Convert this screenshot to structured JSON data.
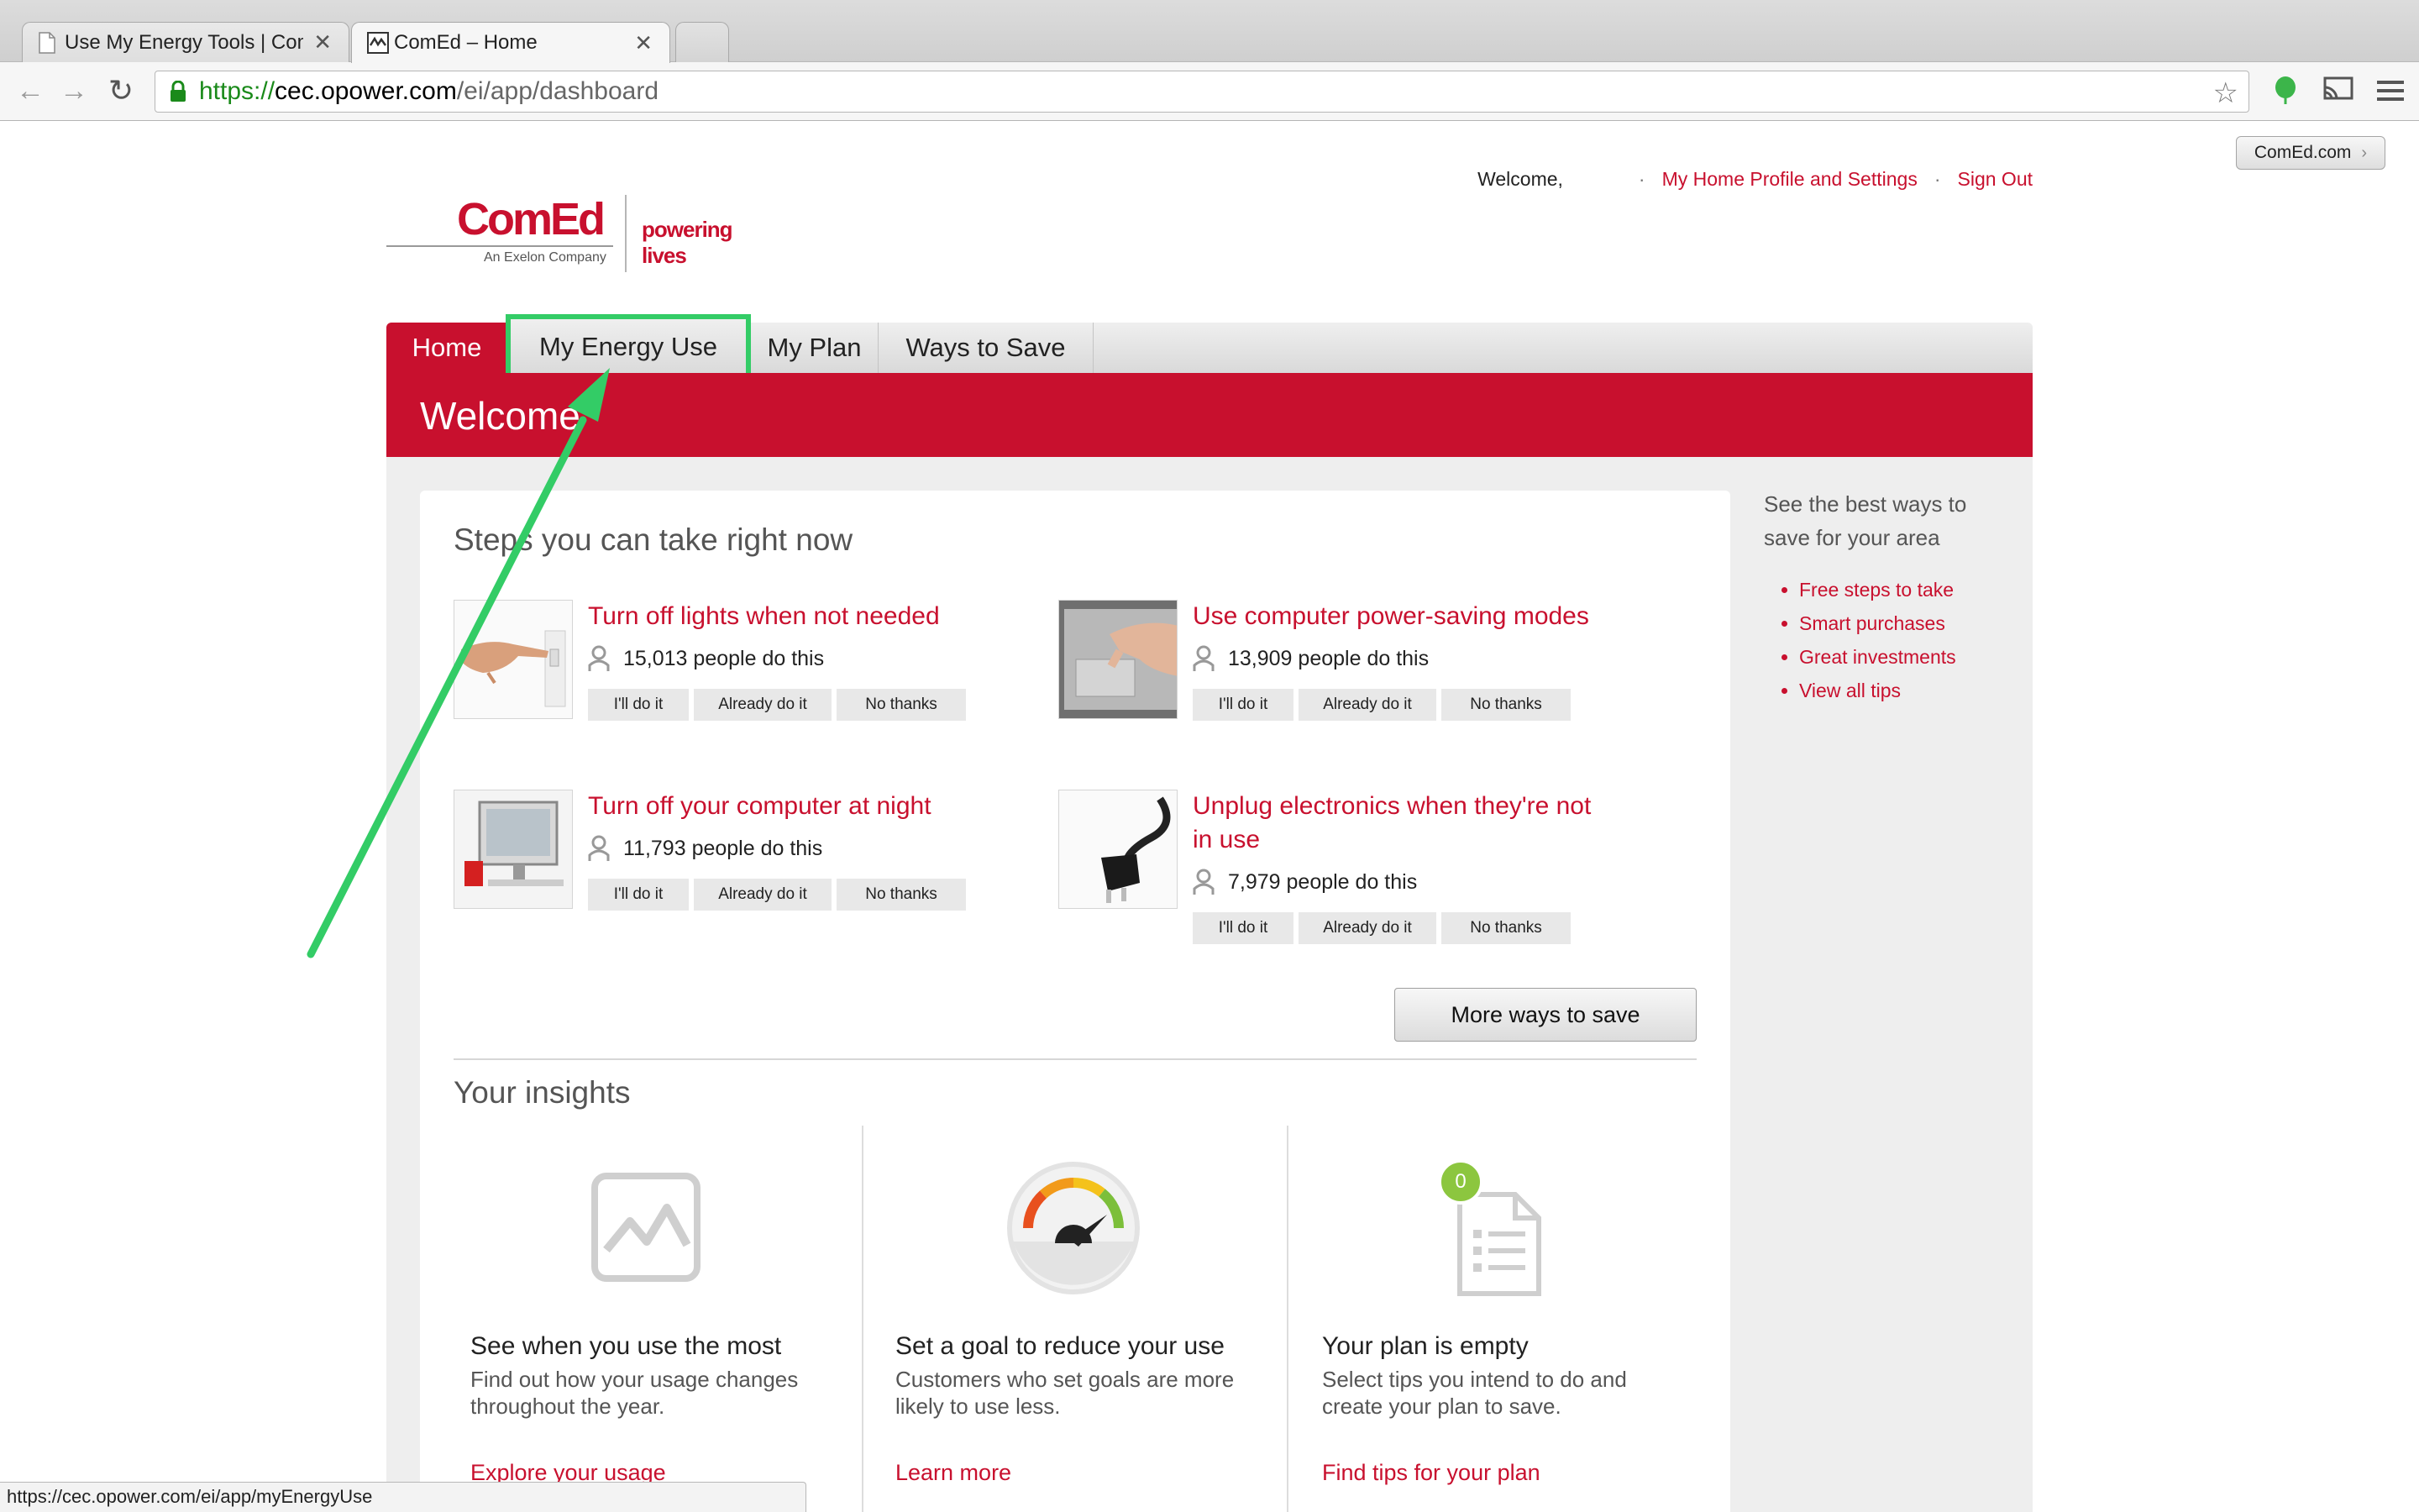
{
  "browser": {
    "tabs": [
      {
        "title": "Use My Energy Tools | Com",
        "active": false
      },
      {
        "title": "ComEd – Home",
        "active": true
      }
    ],
    "url": {
      "scheme": "https://",
      "host": "cec.opower.com",
      "path": "/ei/app/dashboard"
    },
    "status_url": "https://cec.opower.com/ei/app/myEnergyUse",
    "colors": {
      "secure": "#1a8a1a",
      "extension": "#3cb54a"
    }
  },
  "page": {
    "external_link": "ComEd.com",
    "header": {
      "welcome": "Welcome,",
      "profile_link": "My Home Profile and Settings",
      "signout_link": "Sign Out"
    },
    "logo": {
      "brand": "ComEd",
      "subtitle": "An Exelon Company",
      "tagline": "powering lives"
    },
    "nav_tabs": [
      {
        "label": "Home",
        "active": true
      },
      {
        "label": "My Energy Use",
        "highlighted": true
      },
      {
        "label": "My Plan"
      },
      {
        "label": "Ways to Save"
      }
    ],
    "hero_title": "Welcome",
    "steps": {
      "heading": "Steps you can take right now",
      "tips": [
        {
          "title": "Turn off lights when not needed",
          "count": "15,013",
          "suffix": "people do this",
          "image": "hand-switch-photo"
        },
        {
          "title": "Use computer power-saving modes",
          "count": "13,909",
          "suffix": "people do this",
          "image": "laptop-touchpad-photo"
        },
        {
          "title": "Turn off your computer at night",
          "count": "11,793",
          "suffix": "people do this",
          "image": "desktop-computer-photo"
        },
        {
          "title": "Unplug electronics when they're not in use",
          "count": "7,979",
          "suffix": "people do this",
          "image": "power-plug-photo"
        }
      ],
      "buttons": {
        "will_do": "I'll do it",
        "already": "Already do it",
        "no_thanks": "No thanks"
      },
      "more_button": "More ways to save"
    },
    "insights": {
      "heading": "Your insights",
      "items": [
        {
          "icon": "usage-chart-icon",
          "title": "See when you use the most",
          "desc": "Find out how your usage changes throughout the year.",
          "link": "Explore your usage"
        },
        {
          "icon": "goal-gauge-icon",
          "title": "Set a goal to reduce your use",
          "desc": "Customers who set goals are more likely to use less.",
          "link": "Learn more"
        },
        {
          "icon": "plan-document-icon",
          "badge": "0",
          "title": "Your plan is empty",
          "desc": "Select tips you intend to do and create your plan to save.",
          "link": "Find tips for your plan"
        }
      ]
    },
    "sidebar": {
      "intro": "See the best ways to save for your area",
      "links": [
        "Free steps to take",
        "Smart purchases",
        "Great investments",
        "View all tips"
      ]
    },
    "colors": {
      "brand_red": "#c8102e",
      "highlight_green": "#33cc66",
      "badge_green": "#8cc63f"
    }
  }
}
